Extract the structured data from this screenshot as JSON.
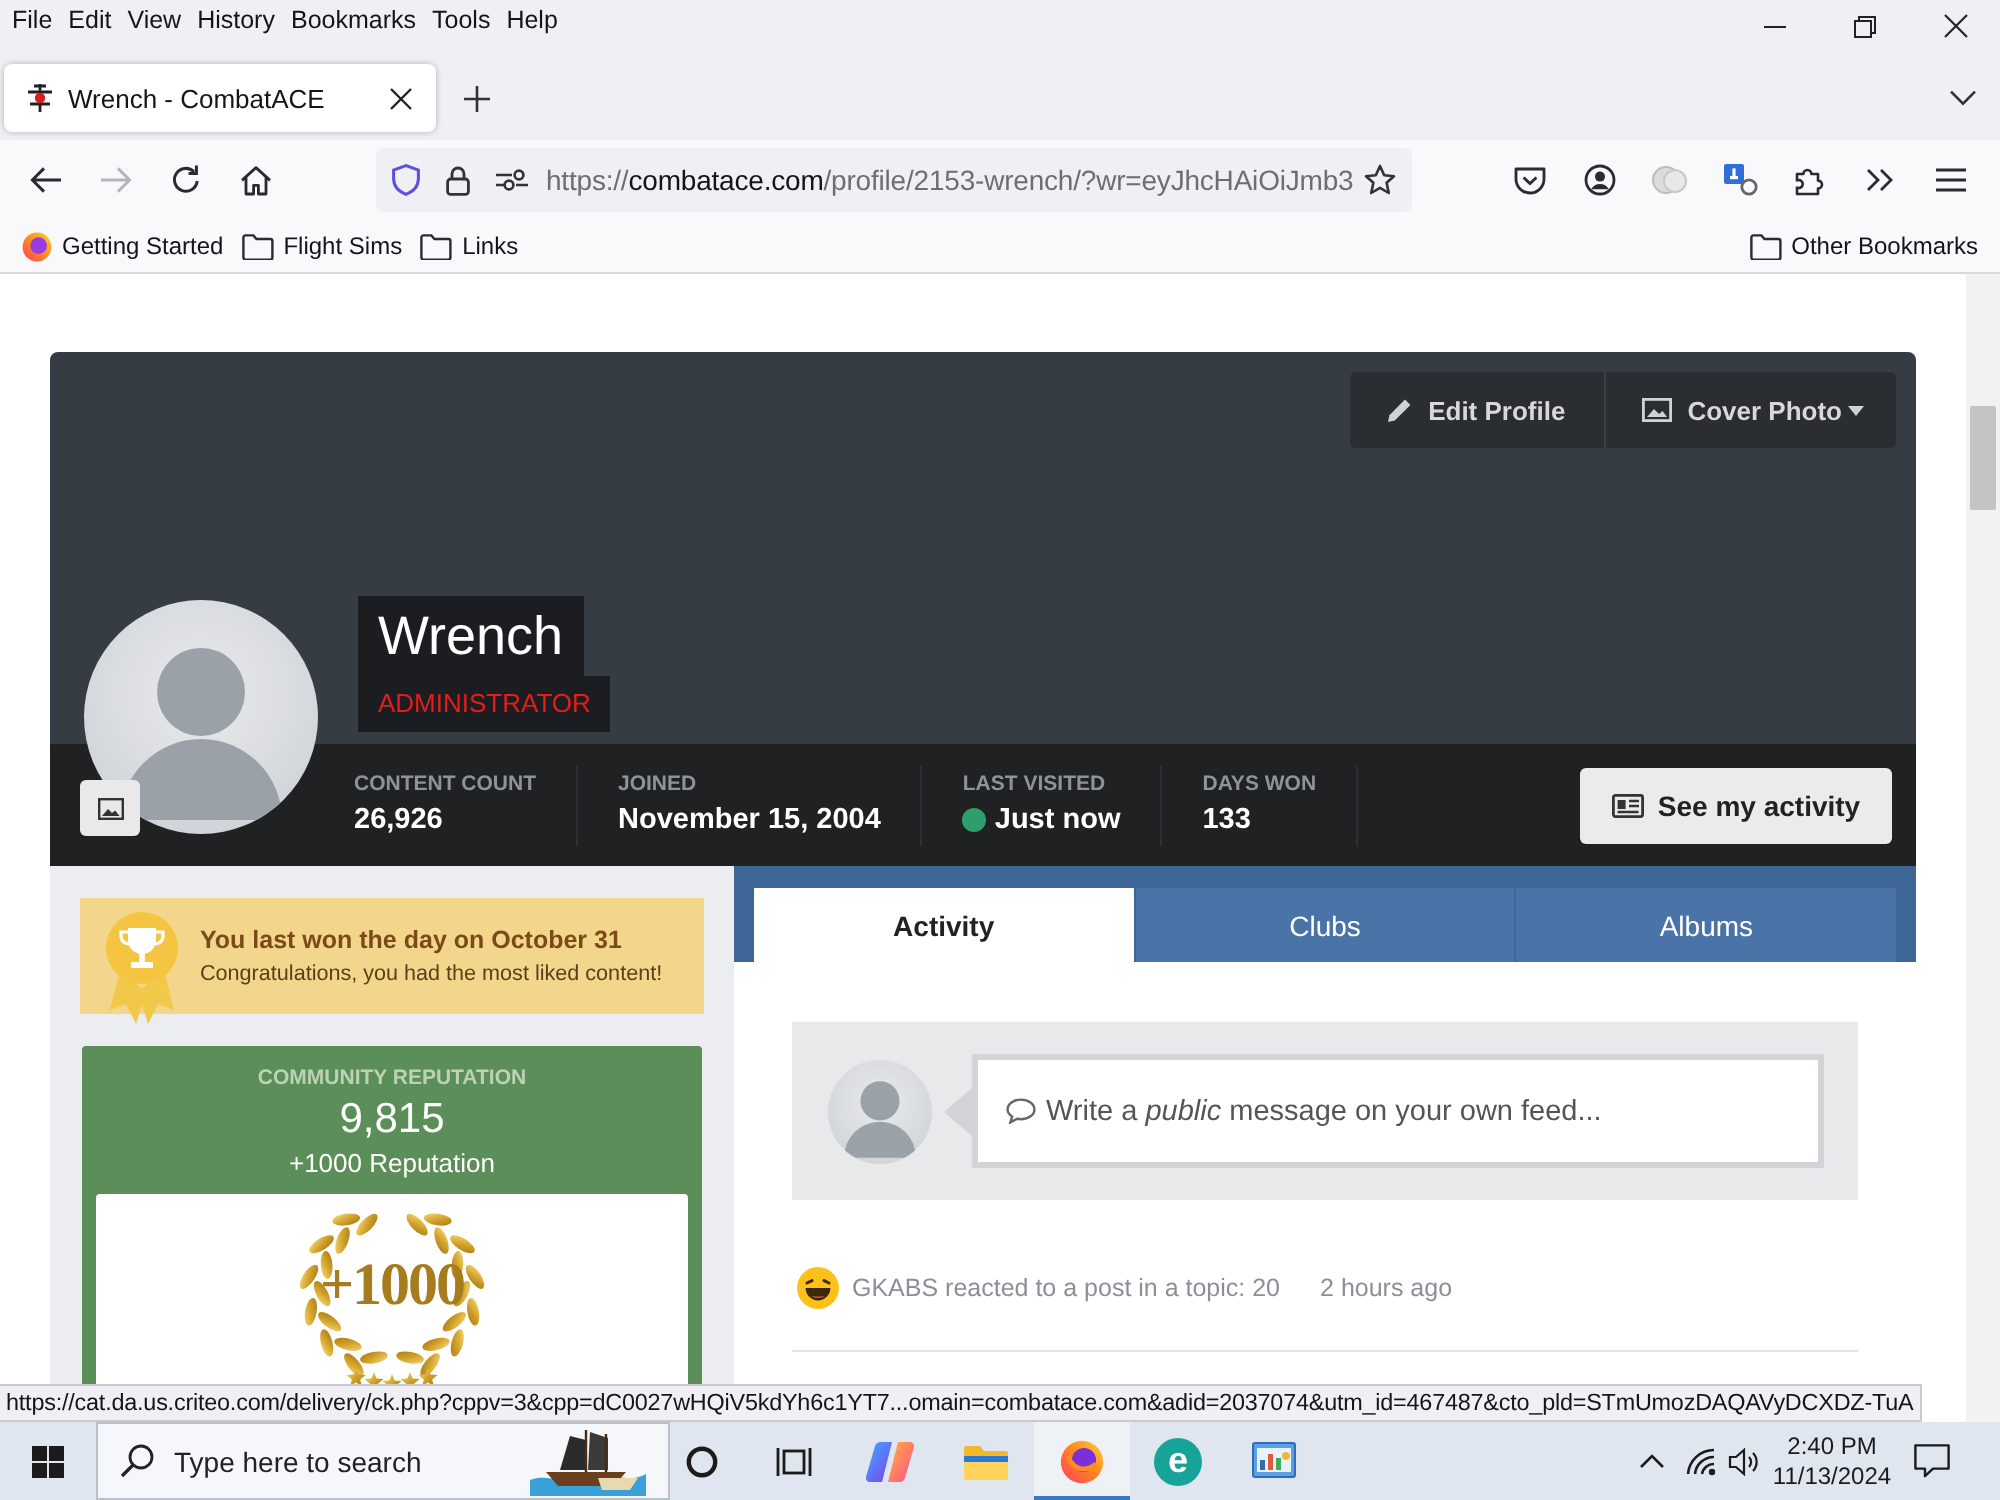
{
  "menu_bar": {
    "items": [
      "File",
      "Edit",
      "View",
      "History",
      "Bookmarks",
      "Tools",
      "Help"
    ]
  },
  "tabs": [
    {
      "title": "Wrench - CombatACE",
      "selected": true
    }
  ],
  "nav_buttons": [
    {
      "kind": "back",
      "disabled": false
    },
    {
      "kind": "forward",
      "disabled": true
    },
    {
      "kind": "reload",
      "disabled": false
    },
    {
      "kind": "home",
      "disabled": false
    }
  ],
  "address_bar": {
    "scheme": "https://",
    "host": "combatace.com",
    "path": "/profile/2153-wrench/?wr=eyJhcHAiOiJmb3"
  },
  "bookmarks": [
    {
      "label": "Getting Started",
      "kind": "site"
    },
    {
      "label": "Flight Sims",
      "kind": "folder"
    },
    {
      "label": "Links",
      "kind": "folder"
    }
  ],
  "other_bookmarks": {
    "label": "Other Bookmarks"
  },
  "profile": {
    "name": "Wrench",
    "role": "ADMINISTRATOR",
    "actions": [
      {
        "label": "Edit Profile",
        "kind": "edit"
      },
      {
        "label": "Cover Photo",
        "kind": "cover",
        "dropdown": true
      }
    ],
    "stats": [
      {
        "label": "CONTENT COUNT",
        "value": "26,926"
      },
      {
        "label": "JOINED",
        "value": "November 15, 2004"
      },
      {
        "label": "LAST VISITED",
        "value": "Just now",
        "online": true
      },
      {
        "label": "DAYS WON",
        "value": "133"
      }
    ],
    "activity_button": {
      "label": "See my activity"
    }
  },
  "day_won": {
    "title": "You last won the day on October 31",
    "message": "Congratulations, you had the most liked content!"
  },
  "reputation": {
    "heading": "COMMUNITY REPUTATION",
    "value": "9,815",
    "rank": "+1000 Reputation",
    "badge_text": "+1000"
  },
  "content_tabs": [
    {
      "label": "Activity",
      "selected": true
    },
    {
      "label": "Clubs",
      "selected": false
    },
    {
      "label": "Albums",
      "selected": false
    }
  ],
  "composer": {
    "placeholder": "Write a *public* message on your own feed..."
  },
  "feed": [
    {
      "text": "GKABS reacted to a post in a topic: 20",
      "time": "2 hours ago"
    }
  ],
  "link_status": {
    "url": "https://cat.da.us.criteo.com/delivery/ck.php?cppv=3&cpp=dC0027wHQiV5kdYh6c1YT7...omain=combatace.com&adid=2037074&utm_id=467487&cto_pld=STmUmozDAQAVyDCXDZ-TuA"
  },
  "taskbar": {
    "search_placeholder": "Type here to search",
    "apps": [
      {
        "kind": "cortana",
        "active": false
      },
      {
        "kind": "task_view",
        "active": false
      },
      {
        "kind": "copilot",
        "active": false
      },
      {
        "kind": "explorer",
        "active": false
      },
      {
        "kind": "firefox",
        "active": true
      },
      {
        "kind": "eset",
        "active": false,
        "glyph": "e"
      },
      {
        "kind": "control_panel",
        "active": false
      }
    ],
    "time": "2:40 PM",
    "date": "11/13/2024"
  }
}
